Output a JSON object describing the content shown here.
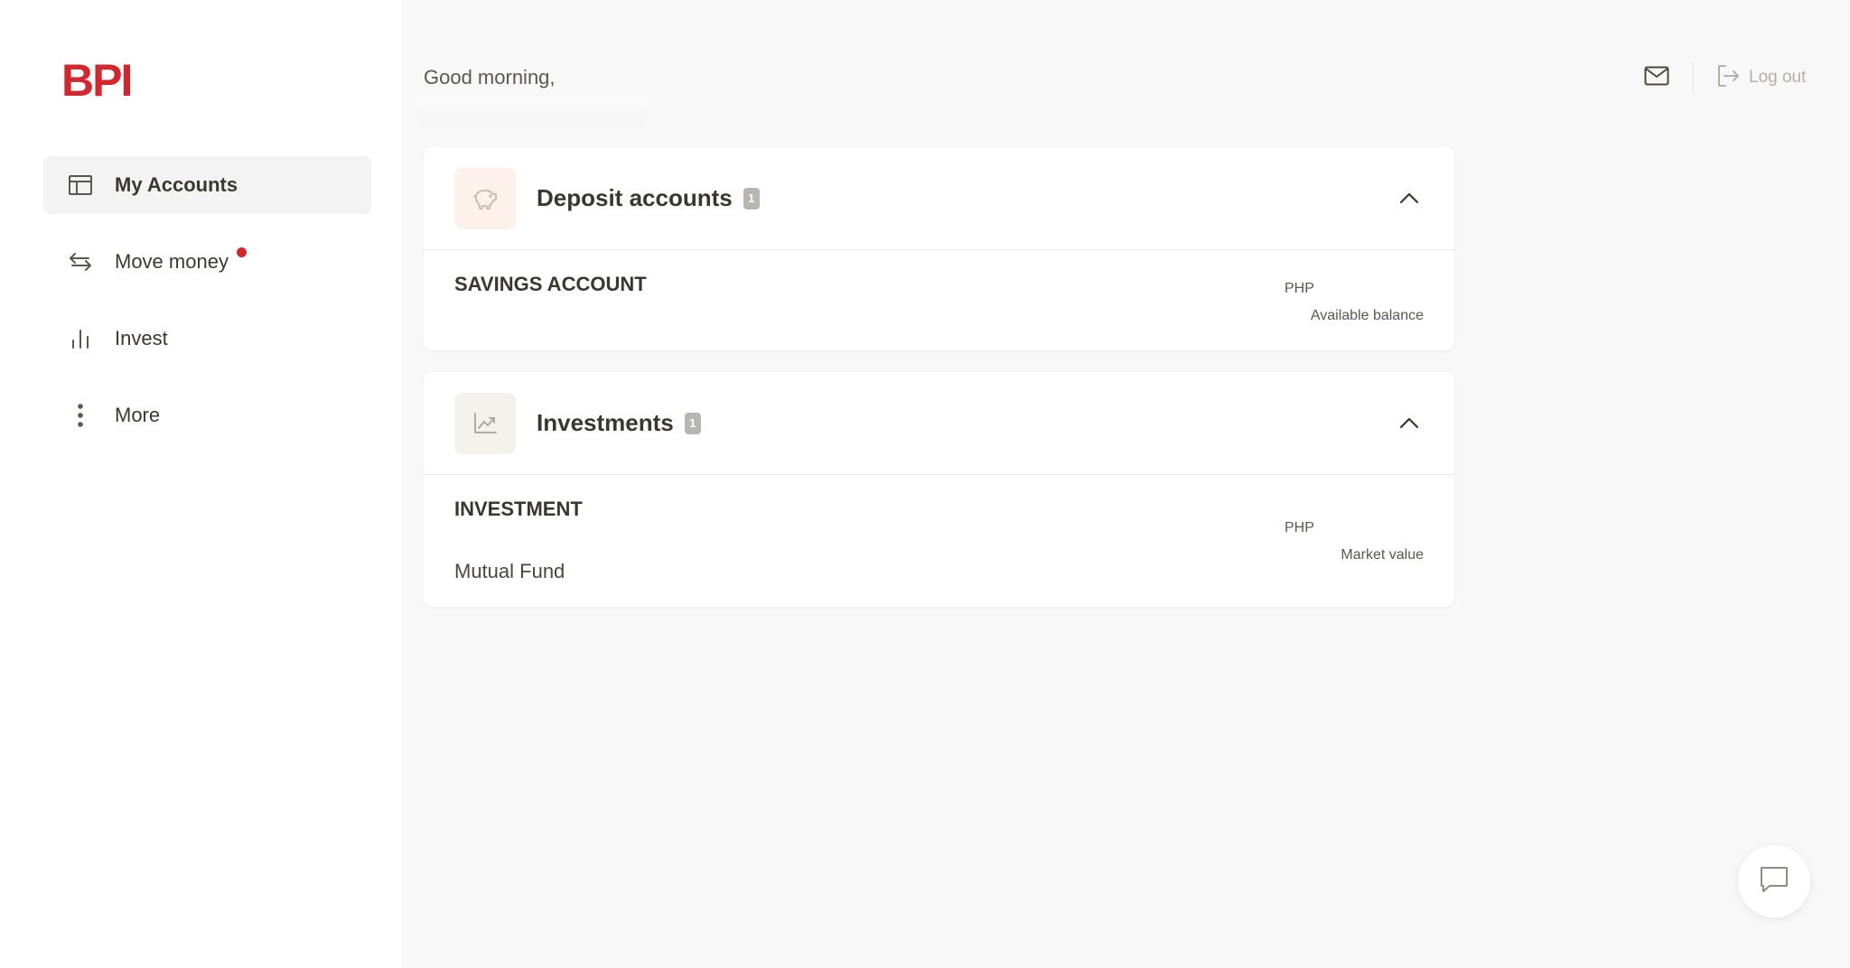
{
  "brand": {
    "logo": "BPI",
    "accent": "#d3262f"
  },
  "sidebar": {
    "items": [
      {
        "label": "My Accounts",
        "icon": "layout-icon",
        "active": true
      },
      {
        "label": "Move money",
        "icon": "transfer-arrows-icon",
        "notification": true
      },
      {
        "label": "Invest",
        "icon": "bar-chart-icon"
      },
      {
        "label": "More",
        "icon": "more-vertical-icon"
      }
    ]
  },
  "header": {
    "greeting": "Good morning,",
    "mail_icon": "mail-icon",
    "logout_label": "Log out",
    "logout_icon": "logout-icon"
  },
  "deposit": {
    "title": "Deposit accounts",
    "count": "1",
    "icon": "piggy-bank-icon",
    "icon_bg": "#fdf1ec",
    "account": {
      "name": "SAVINGS ACCOUNT",
      "currency": "PHP",
      "balance_label": "Available balance"
    }
  },
  "investments": {
    "title": "Investments",
    "count": "1",
    "icon": "trend-chart-icon",
    "icon_bg": "#f3f2ed",
    "account": {
      "name": "INVESTMENT",
      "subtitle": "Mutual Fund",
      "currency": "PHP",
      "balance_label": "Market value"
    }
  },
  "chat": {
    "icon": "chat-bubble-icon"
  }
}
